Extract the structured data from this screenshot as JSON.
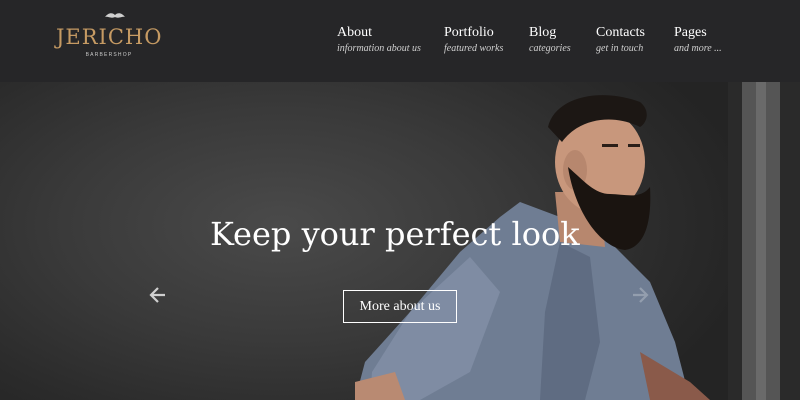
{
  "brand": {
    "name": "JERICHO",
    "tagline": "BARBERSHOP",
    "accent_color": "#c59a63"
  },
  "nav": {
    "items": [
      {
        "title": "About",
        "subtitle": "information about us"
      },
      {
        "title": "Portfolio",
        "subtitle": "featured works"
      },
      {
        "title": "Blog",
        "subtitle": "categories"
      },
      {
        "title": "Contacts",
        "subtitle": "get in touch"
      },
      {
        "title": "Pages",
        "subtitle": "and more ..."
      }
    ]
  },
  "hero": {
    "headline": "Keep your perfect look",
    "cta_label": "More about us",
    "prev_icon": "arrow-left-icon",
    "next_icon": "arrow-right-icon"
  }
}
